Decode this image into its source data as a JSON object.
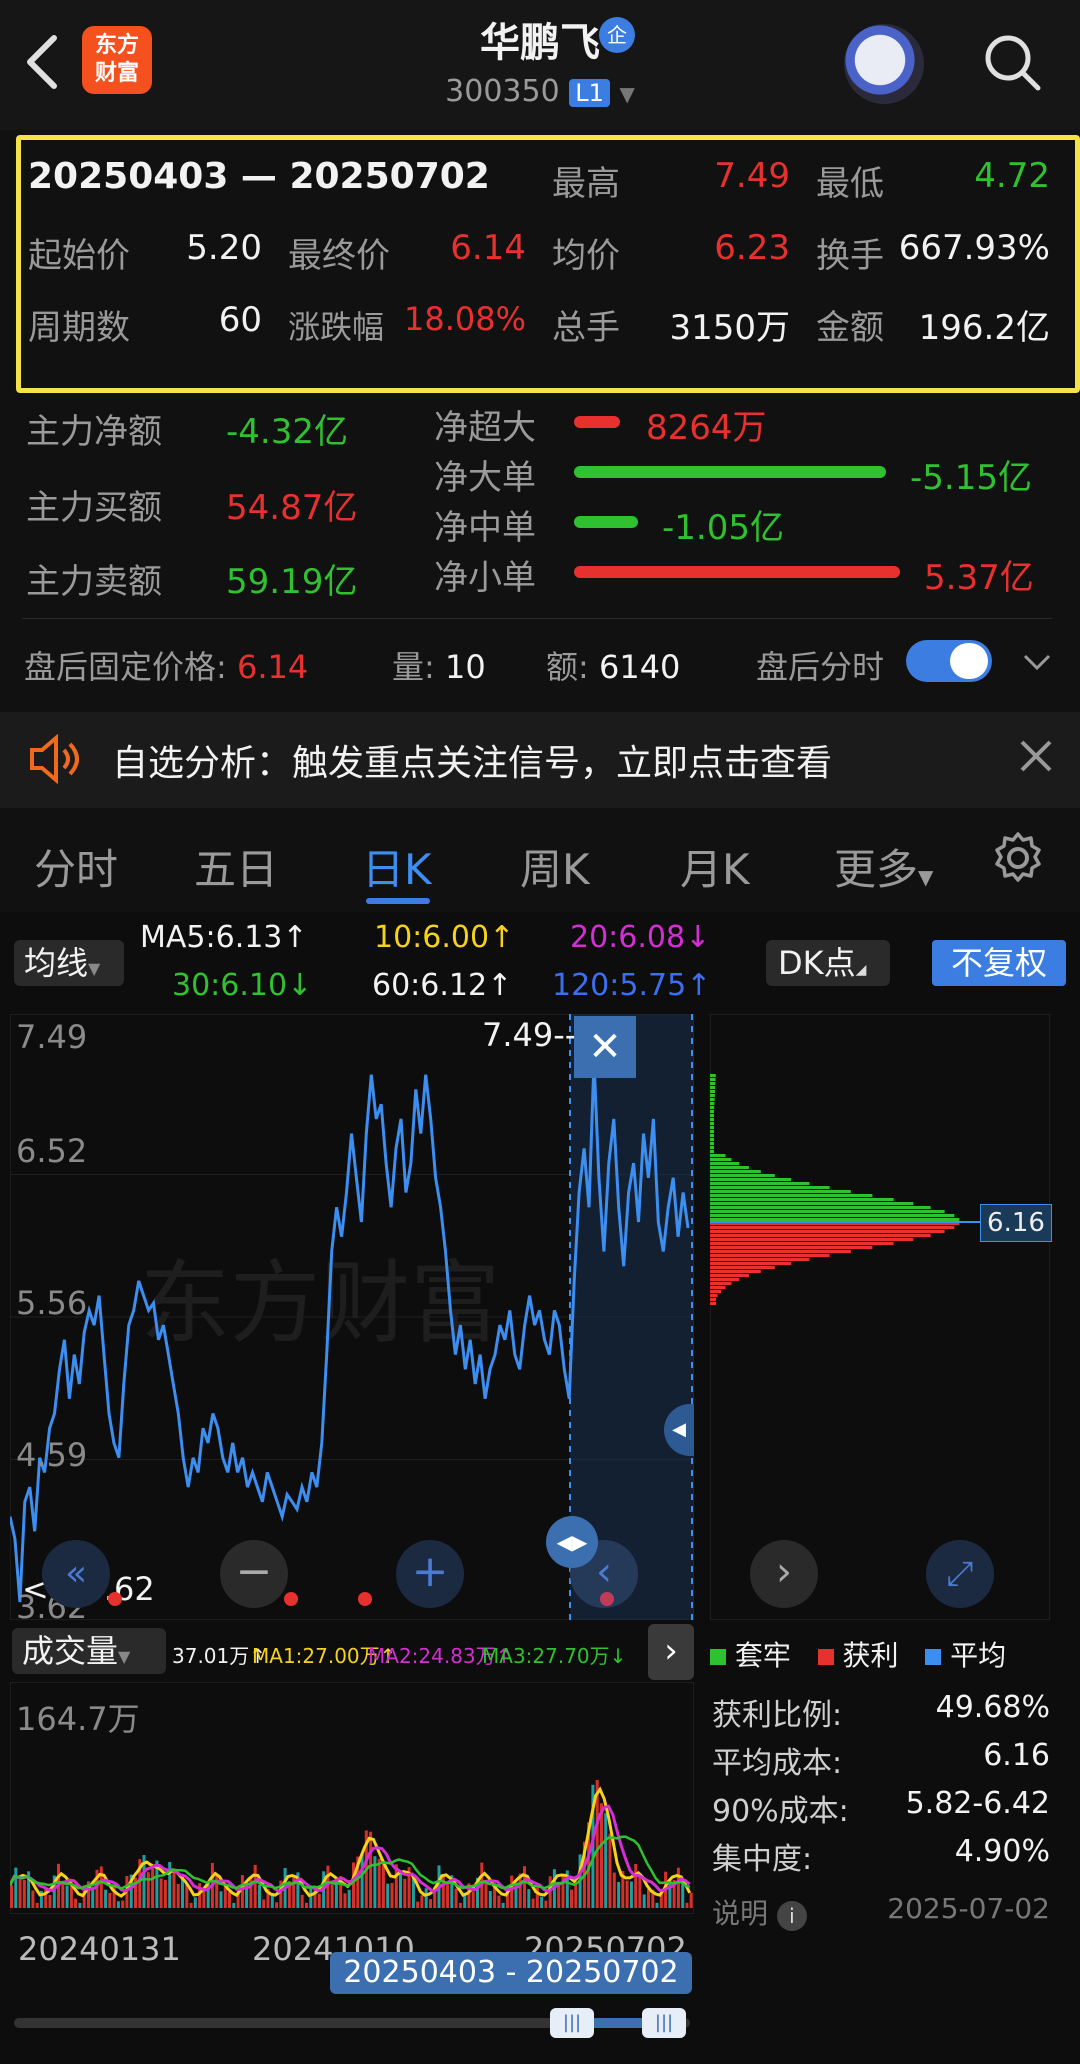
{
  "header": {
    "logo_line1": "东方",
    "logo_line2": "财富",
    "stock_name": "华鹏飞",
    "stock_badge": "企",
    "stock_code": "300350",
    "level": "L1"
  },
  "period": {
    "range": "20250403 — 20250702",
    "high_label": "最高",
    "high": "7.49",
    "low_label": "最低",
    "low": "4.72",
    "start_label": "起始价",
    "start": "5.20",
    "end_label": "最终价",
    "end": "6.14",
    "avg_label": "均价",
    "avg": "6.23",
    "turnover_label": "换手",
    "turnover": "667.93%",
    "periods_label": "周期数",
    "periods": "60",
    "change_label": "涨跌幅",
    "change": "18.08%",
    "volume_label": "总手",
    "volume": "3150万",
    "amount_label": "金额",
    "amount": "196.2亿"
  },
  "flow": {
    "main_net_label": "主力净额",
    "main_net": "-4.32亿",
    "main_buy_label": "主力买额",
    "main_buy": "54.87亿",
    "main_sell_label": "主力卖额",
    "main_sell": "59.19亿",
    "xl_label": "净超大",
    "xl": "8264万",
    "l_label": "净大单",
    "l": "-5.15亿",
    "m_label": "净中单",
    "m": "-1.05亿",
    "s_label": "净小单",
    "s": "5.37亿"
  },
  "after_hours": {
    "price_label": "盘后固定价格:",
    "price": "6.14",
    "vol_label": "量:",
    "vol": "10",
    "amt_label": "额:",
    "amt": "6140",
    "toggle_label": "盘后分时",
    "toggle_on": true
  },
  "notice": {
    "text": "自选分析：触发重点关注信号，立即点击查看"
  },
  "tabs": [
    "分时",
    "五日",
    "日K",
    "周K",
    "月K",
    "更多"
  ],
  "active_tab": "日K",
  "ma": {
    "selector": "均线",
    "ma5": "MA5:6.13↑",
    "ma10": "10:6.00↑",
    "ma20": "20:6.08↓",
    "ma30": "30:6.10↓",
    "ma60": "60:6.12↑",
    "ma120": "120:5.75↑",
    "dk": "DK点",
    "fq": "不复权"
  },
  "price_axis": [
    "7.49",
    "6.52",
    "5.56",
    "4.59",
    "3.62"
  ],
  "price_marks": {
    "high_tag": "7.49-->",
    "low_tag": "<---3.62"
  },
  "price_chart": {
    "type": "line",
    "values": [
      4.2,
      4.05,
      3.62,
      4.3,
      4.4,
      4.1,
      4.6,
      4.5,
      4.8,
      4.9,
      5.2,
      5.4,
      5.0,
      5.3,
      5.1,
      5.45,
      5.6,
      5.5,
      5.7,
      5.3,
      4.9,
      4.7,
      4.6,
      5.1,
      5.5,
      5.6,
      5.8,
      5.7,
      5.6,
      5.65,
      5.4,
      5.5,
      5.3,
      5.1,
      4.9,
      4.6,
      4.4,
      4.6,
      4.5,
      4.8,
      4.7,
      4.9,
      4.8,
      4.6,
      4.5,
      4.7,
      4.5,
      4.6,
      4.4,
      4.5,
      4.4,
      4.3,
      4.5,
      4.4,
      4.3,
      4.2,
      4.35,
      4.3,
      4.25,
      4.4,
      4.3,
      4.5,
      4.4,
      4.7,
      5.3,
      6.0,
      6.3,
      6.1,
      6.4,
      6.8,
      6.5,
      6.2,
      6.8,
      7.2,
      6.9,
      7.0,
      6.6,
      6.3,
      6.7,
      6.9,
      6.4,
      6.6,
      7.1,
      6.8,
      7.2,
      6.9,
      6.5,
      6.3,
      6.0,
      5.6,
      5.3,
      5.5,
      5.2,
      5.4,
      5.1,
      5.3,
      5.0,
      5.2,
      5.3,
      5.5,
      5.4,
      5.6,
      5.3,
      5.2,
      5.5,
      5.7,
      5.5,
      5.6,
      5.4,
      5.3,
      5.6,
      5.5,
      5.2,
      5.0,
      5.8,
      6.4,
      6.7,
      6.3,
      7.3,
      6.5,
      6.0,
      6.6,
      6.9,
      6.3,
      5.9,
      6.4,
      6.6,
      6.2,
      6.8,
      6.5,
      6.9,
      6.2,
      6.0,
      6.3,
      6.5,
      6.1,
      6.4,
      6.16
    ],
    "ylim": [
      3.62,
      7.49
    ]
  },
  "chip": {
    "price_tag": "6.16",
    "legend_trap": "套牢",
    "legend_profit": "获利",
    "legend_avg": "平均",
    "profit_ratio_label": "获利比例:",
    "profit_ratio": "49.68%",
    "avg_cost_label": "平均成本:",
    "avg_cost": "6.16",
    "cost90_label": "90%成本:",
    "cost90": "5.82-6.42",
    "concentration_label": "集中度:",
    "concentration": "4.90%",
    "note_label": "说明",
    "date": "2025-07-02"
  },
  "volume": {
    "selector": "成交量",
    "v": "37.01万↑",
    "ma1": "MA1:27.00万↑",
    "ma2": "MA2:24.83万↑",
    "ma3": "MA3:27.70万↓",
    "axis_max": "164.7万"
  },
  "dates": {
    "d1": "20240131",
    "d2": "20241010",
    "d3": "20250702",
    "range": "20250403 - 20250702"
  },
  "colors": {
    "red": "#e8312f",
    "green": "#2fc12f",
    "blue": "#3c8ef0",
    "yellow": "#f5e14a",
    "bg": "#111111"
  }
}
